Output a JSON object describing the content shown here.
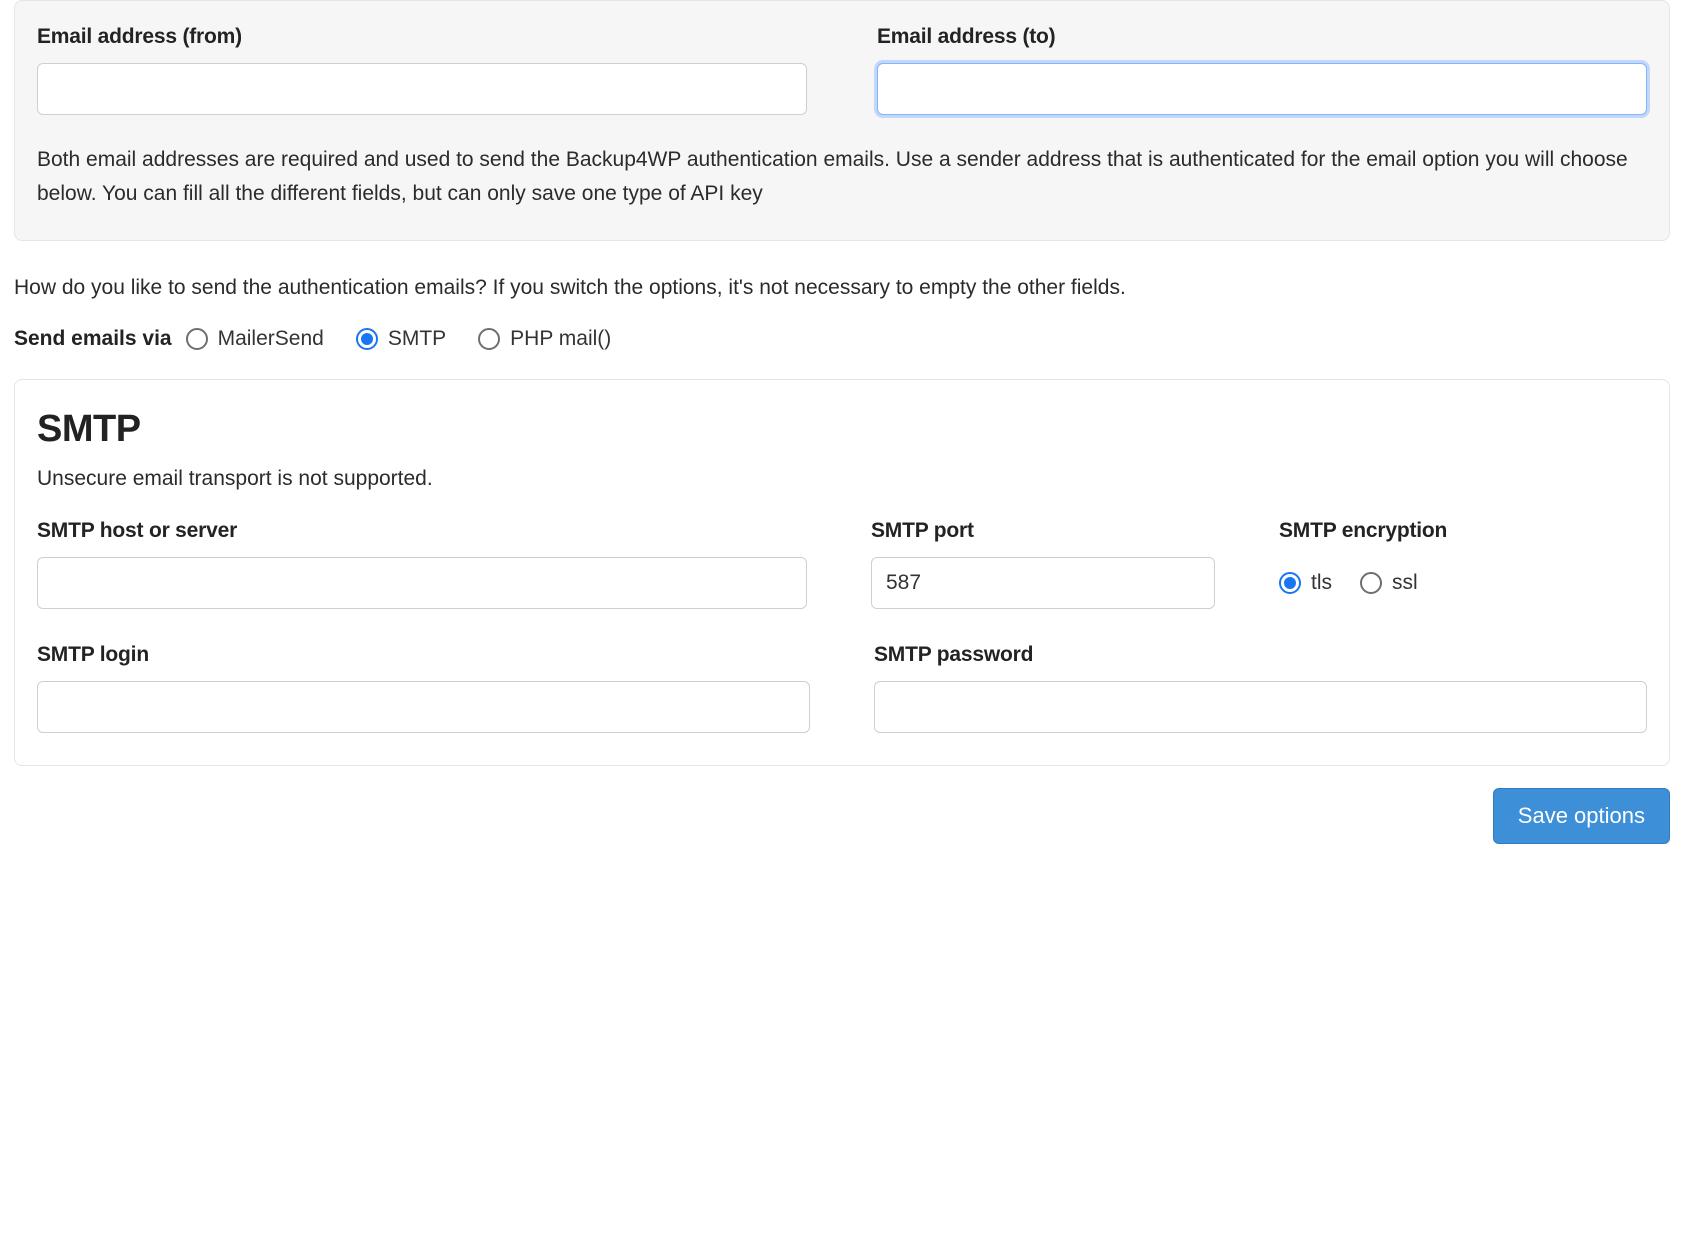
{
  "emailBlock": {
    "from_label": "Email address (from)",
    "to_label": "Email address (to)",
    "from_value": "",
    "to_value": "",
    "help_text": "Both email addresses are required and used to send the Backup4WP authentication emails. Use a sender address that is authenticated for the email option you will choose below. You can fill all the different fields, but can only save one type of API key"
  },
  "sendVia": {
    "question": "How do you like to send the authentication emails? If you switch the options, it's not necessary to empty the other fields.",
    "label": "Send emails via",
    "options": {
      "mailersend": "MailerSend",
      "smtp": "SMTP",
      "phpmail": "PHP mail()"
    },
    "selected": "smtp"
  },
  "smtp": {
    "title": "SMTP",
    "subtitle": "Unsecure email transport is not supported.",
    "host_label": "SMTP host or server",
    "host_value": "",
    "port_label": "SMTP port",
    "port_value": "587",
    "enc_label": "SMTP encryption",
    "enc_options": {
      "tls": "tls",
      "ssl": "ssl"
    },
    "enc_selected": "tls",
    "login_label": "SMTP login",
    "login_value": "",
    "password_label": "SMTP password",
    "password_value": ""
  },
  "buttons": {
    "save": "Save options"
  }
}
